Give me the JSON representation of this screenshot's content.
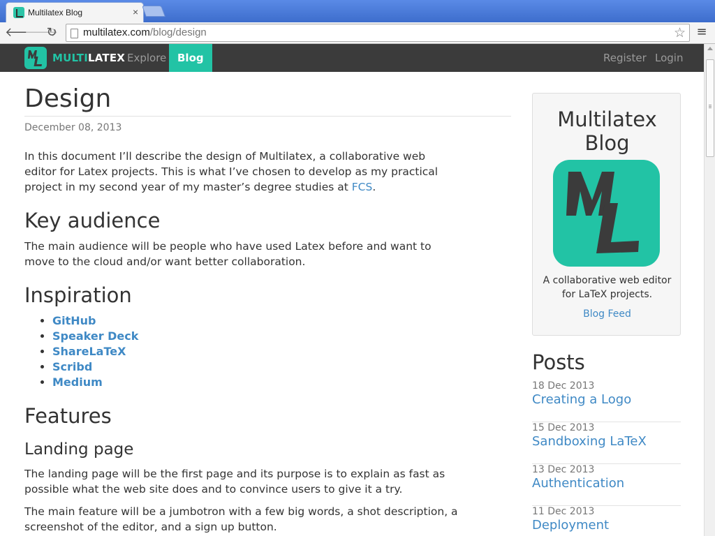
{
  "browser": {
    "tab_title": "Multilatex Blog",
    "tab_close": "×",
    "url_host": "multilatex.com",
    "url_path": "/blog/design"
  },
  "navbar": {
    "brand_part1": "MULTI",
    "brand_part2": "LATEX",
    "links": [
      {
        "label": "Explore",
        "active": false
      },
      {
        "label": "Blog",
        "active": true
      }
    ],
    "right_links": [
      "Register",
      "Login"
    ]
  },
  "article": {
    "title": "Design",
    "date": "December 08, 2013",
    "intro_text": "In this document I’ll describe the design of Multilatex, a collaborative web editor for Latex projects. This is what I’ve chosen to develop as my practical project in my second year of my master’s degree studies at ",
    "intro_link": "FCS",
    "intro_end": ".",
    "sections": [
      {
        "heading": "Key audience",
        "text": "The main audience will be people who have used Latex before and want to move to the cloud and/or want better collaboration."
      },
      {
        "heading": "Inspiration"
      },
      {
        "heading": "Features"
      }
    ],
    "inspiration_links": [
      "GitHub",
      "Speaker Deck",
      "ShareLaTeX",
      "Scribd",
      "Medium"
    ],
    "subsection": {
      "heading": "Landing page",
      "paragraphs": [
        "The landing page will be the first page and its purpose is to explain as fast as possible what the web site does and to convince users to give it a try.",
        "The main feature will be a jumbotron with a few big words, a shot description, a screenshot of the editor, and a sign up button."
      ]
    }
  },
  "sidebar": {
    "title": "Multilatex Blog",
    "description": "A collaborative web editor for LaTeX projects.",
    "feed_link": "Blog Feed",
    "posts_heading": "Posts",
    "posts": [
      {
        "date": "18 Dec 2013",
        "title": "Creating a Logo"
      },
      {
        "date": "15 Dec 2013",
        "title": "Sandboxing LaTeX"
      },
      {
        "date": "13 Dec 2013",
        "title": "Authentication"
      },
      {
        "date": "11 Dec 2013",
        "title": "Deployment"
      }
    ]
  },
  "colors": {
    "accent": "#22c3a5",
    "navbar_bg": "#3b3b3b",
    "link": "#3f89c5",
    "text": "#333333"
  },
  "icons": [
    "back-icon",
    "forward-icon",
    "reload-icon",
    "page-icon",
    "star-icon",
    "menu-icon",
    "multilatex-logo"
  ]
}
